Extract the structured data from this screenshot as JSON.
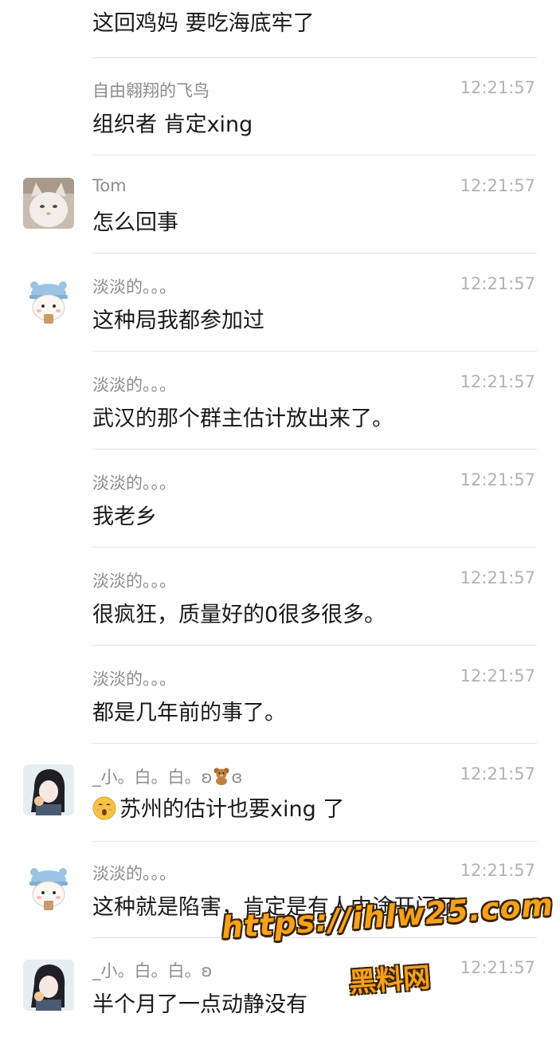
{
  "messages": [
    {
      "sender": "",
      "time": "",
      "text": "这回鸡妈 要吃海底牢了",
      "avatar": "none"
    },
    {
      "sender": "自由翱翔的飞鸟",
      "time": "12:21:57",
      "text": "组织者 肯定xing",
      "avatar": "none"
    },
    {
      "sender": "Tom",
      "time": "12:21:57",
      "text": "怎么回事",
      "avatar": "cat-photo"
    },
    {
      "sender": "淡淡的。。。",
      "time": "12:21:57",
      "text": "这种局我都参加过",
      "avatar": "bear-hat-cartoon"
    },
    {
      "sender": "淡淡的。。。",
      "time": "12:21:57",
      "text": "武汉的那个群主估计放出来了。",
      "avatar": "none"
    },
    {
      "sender": "淡淡的。。。",
      "time": "12:21:57",
      "text": "我老乡",
      "avatar": "none"
    },
    {
      "sender": "淡淡的。。。",
      "time": "12:21:57",
      "text": "很疯狂，质量好的0很多很多。",
      "avatar": "none"
    },
    {
      "sender": "淡淡的。。。",
      "time": "12:21:57",
      "text": "都是几年前的事了。",
      "avatar": "none"
    },
    {
      "sender": "_小。白。白。ʚ",
      "sender_suffix": "ɞ",
      "time": "12:21:57",
      "text": "苏州的估计也要xing 了",
      "avatar": "girl-illustration",
      "text_emoji": "surprised-face-emoji",
      "name_emoji": "teddy-bear-emoji"
    },
    {
      "sender": "淡淡的。。。",
      "time": "12:21:57",
      "text": "这种就是陷害，肯定是有人中途开门了。",
      "avatar": "bear-hat-cartoon"
    },
    {
      "sender": "_小。白。白。ʚ",
      "time": "12:21:57",
      "text": "半个月了一点动静没有",
      "avatar": "girl-illustration"
    }
  ],
  "watermark": {
    "url": "https://ihlw25.com",
    "name": "黑料网"
  }
}
